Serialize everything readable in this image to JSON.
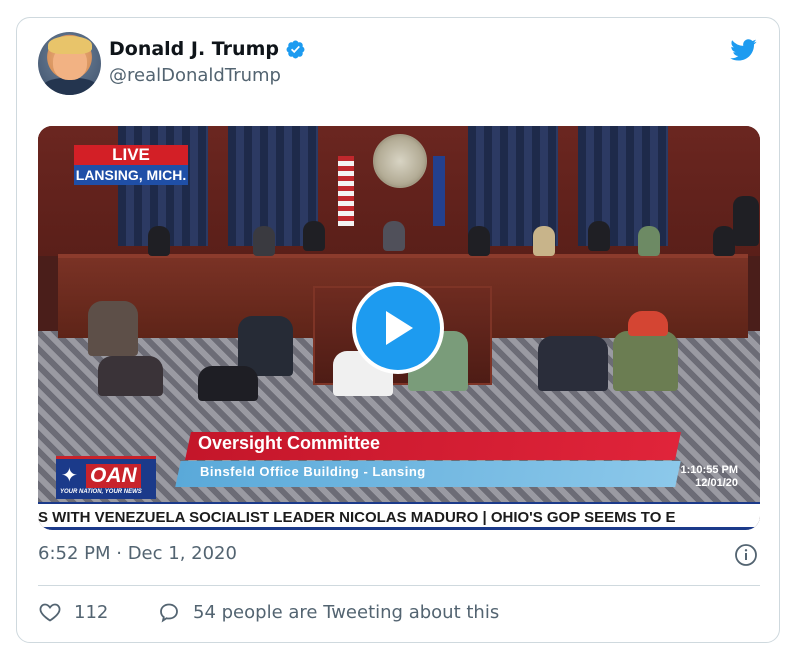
{
  "tweet": {
    "author_name": "Donald J. Trump",
    "handle": "@realDonaldTrump",
    "verified": true,
    "timestamp": "6:52 PM · Dec 1, 2020",
    "likes": "112",
    "replies_text": "54 people are Tweeting about this"
  },
  "video": {
    "live_label": "LIVE",
    "location_label": "LANSING, MICH.",
    "headline": "Oversight Committee",
    "subheadline": "Binsfeld Office Building - Lansing",
    "time": "1:10:55 PM",
    "date": "12/01/20",
    "network_logo": "OAN",
    "network_tagline": "YOUR NATION, YOUR NEWS",
    "ticker_text": "S WITH VENEZUELA SOCIALIST LEADER NICOLAS MADURO  |  OHIO'S GOP SEEMS TO E"
  },
  "icons": {
    "verified": "verified-badge-icon",
    "brand": "twitter-bird-icon",
    "play": "play-icon",
    "info": "info-icon",
    "like": "heart-icon",
    "reply": "speech-bubble-icon"
  },
  "colors": {
    "accent": "#1d9bf0",
    "text_primary": "#0f1419",
    "text_secondary": "#536471",
    "border": "#cfd9de"
  }
}
